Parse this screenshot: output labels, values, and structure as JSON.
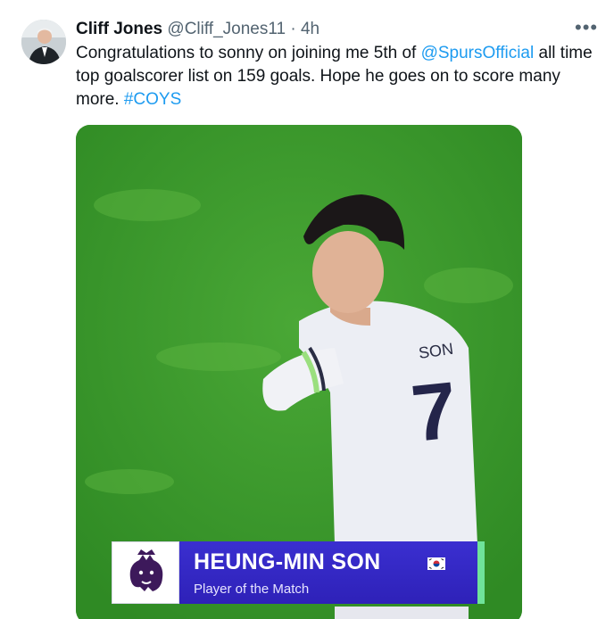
{
  "tweet": {
    "author_name": "Cliff Jones",
    "author_handle": "@Cliff_Jones11",
    "separator": "·",
    "time": "4h",
    "more_icon": "more-horizontal-icon",
    "text_part1": "Congratulations to sonny on joining me  5th of ",
    "mention": "@SpursOfficial",
    "text_part2": " all time top goalscorer list on 159 goals. Hope he goes on to score many more. ",
    "hashtag": "#COYS"
  },
  "media": {
    "player_name": "HEUNG-MIN SON",
    "subtitle": "Player of the Match",
    "shirt_name": "SON",
    "shirt_number": "7",
    "logo_icon": "premier-league-lion-icon",
    "flag_icon": "south-korea-flag-icon",
    "colors": {
      "pitch": "#3f9a2d",
      "banner": "#3a2fd0",
      "accent": "#6fe39a",
      "link": "#1d9bf0"
    }
  }
}
